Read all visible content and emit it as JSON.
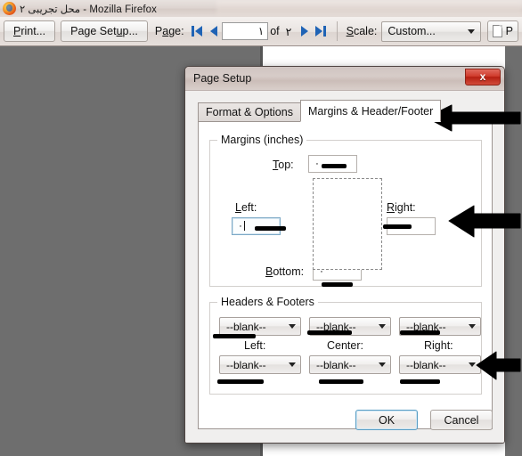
{
  "window": {
    "title": "محل تجریبی ٢ - Mozilla Firefox",
    "logo_icon": "firefox-logo-icon"
  },
  "toolbar": {
    "print_label": "Print...",
    "page_setup_label": "Page Setup...",
    "page_label": "Page:",
    "first_page_icon": "first-page-icon",
    "prev_page_icon": "previous-page-icon",
    "next_page_icon": "next-page-icon",
    "last_page_icon": "last-page-icon",
    "page_number_value": "١",
    "of_label": "of",
    "total_pages": "٢",
    "scale_label": "Scale:",
    "scale_value": "Custom...",
    "scale_caret_icon": "chevron-down-icon",
    "orientation_button_label": "P",
    "orientation_icon": "portrait-page-icon"
  },
  "dialog": {
    "title": "Page Setup",
    "close_icon": "close-icon",
    "close_label": "x",
    "tabs": [
      {
        "label": "Format & Options",
        "selected": false
      },
      {
        "label": "Margins & Header/Footer",
        "selected": true
      }
    ],
    "margins": {
      "legend": "Margins (inches)",
      "top_label": "Top:",
      "top_value": "٠",
      "left_label": "Left:",
      "left_value": "٠",
      "right_label": "Right:",
      "right_value": "٠",
      "bottom_label": "Bottom:",
      "bottom_value": "٠"
    },
    "headers_footers": {
      "legend": "Headers & Footers",
      "header_left": "--blank--",
      "header_center": "--blank--",
      "header_right": "--blank--",
      "col_left_label": "Left:",
      "col_center_label": "Center:",
      "col_right_label": "Right:",
      "footer_left": "--blank--",
      "footer_center": "--blank--",
      "footer_right": "--blank--",
      "dropdown_caret_icon": "chevron-down-icon"
    },
    "ok_label": "OK",
    "cancel_label": "Cancel"
  },
  "annotations": {
    "arrow_tab_icon": "left-arrow-annotation",
    "arrow_margin_icon": "left-arrow-annotation",
    "arrow_headers_icon": "left-arrow-annotation",
    "marker_color": "#000000"
  }
}
